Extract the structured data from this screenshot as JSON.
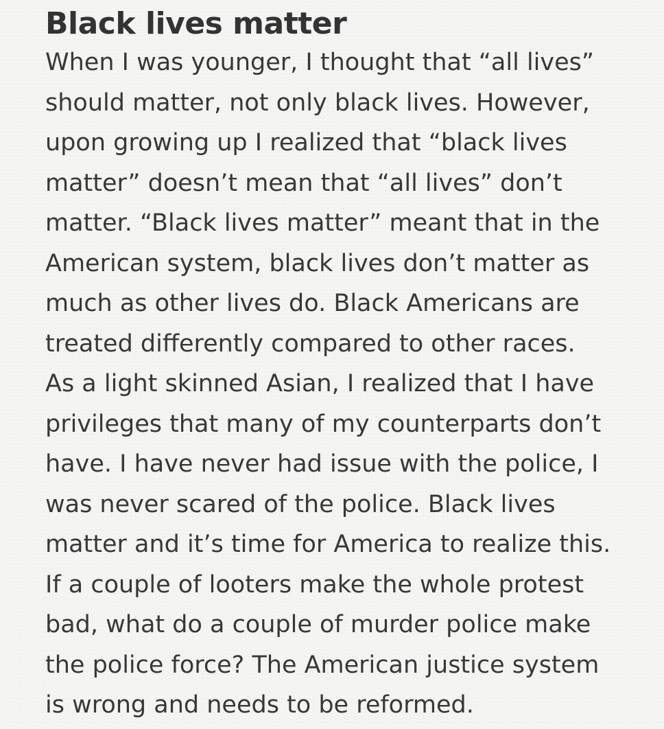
{
  "note": {
    "title": "Black lives matter",
    "lines": [
      "When I was younger, I thought that “all lives”",
      "should matter, not only black lives. However,",
      "upon growing up I realized that “black lives",
      "matter” doesn’t mean that “all lives” don’t",
      "matter. “Black lives matter” meant that in the",
      "American system, black lives don’t matter as",
      "much as other lives do. Black Americans are",
      "treated differently compared to other races.",
      "As a light skinned Asian, I realized that I have",
      "privileges that many of my counterparts don’t",
      "have. I have never had issue with the police, I",
      "was never scared of the police. Black lives",
      "matter and it’s time for America to realize this.",
      "If a couple of looters make the whole protest",
      "bad, what do a couple of murder police make",
      "the police force? The American justice system",
      "is wrong and needs to be reformed."
    ]
  },
  "colors": {
    "background": "#f4f4f2",
    "text": "#333333"
  }
}
